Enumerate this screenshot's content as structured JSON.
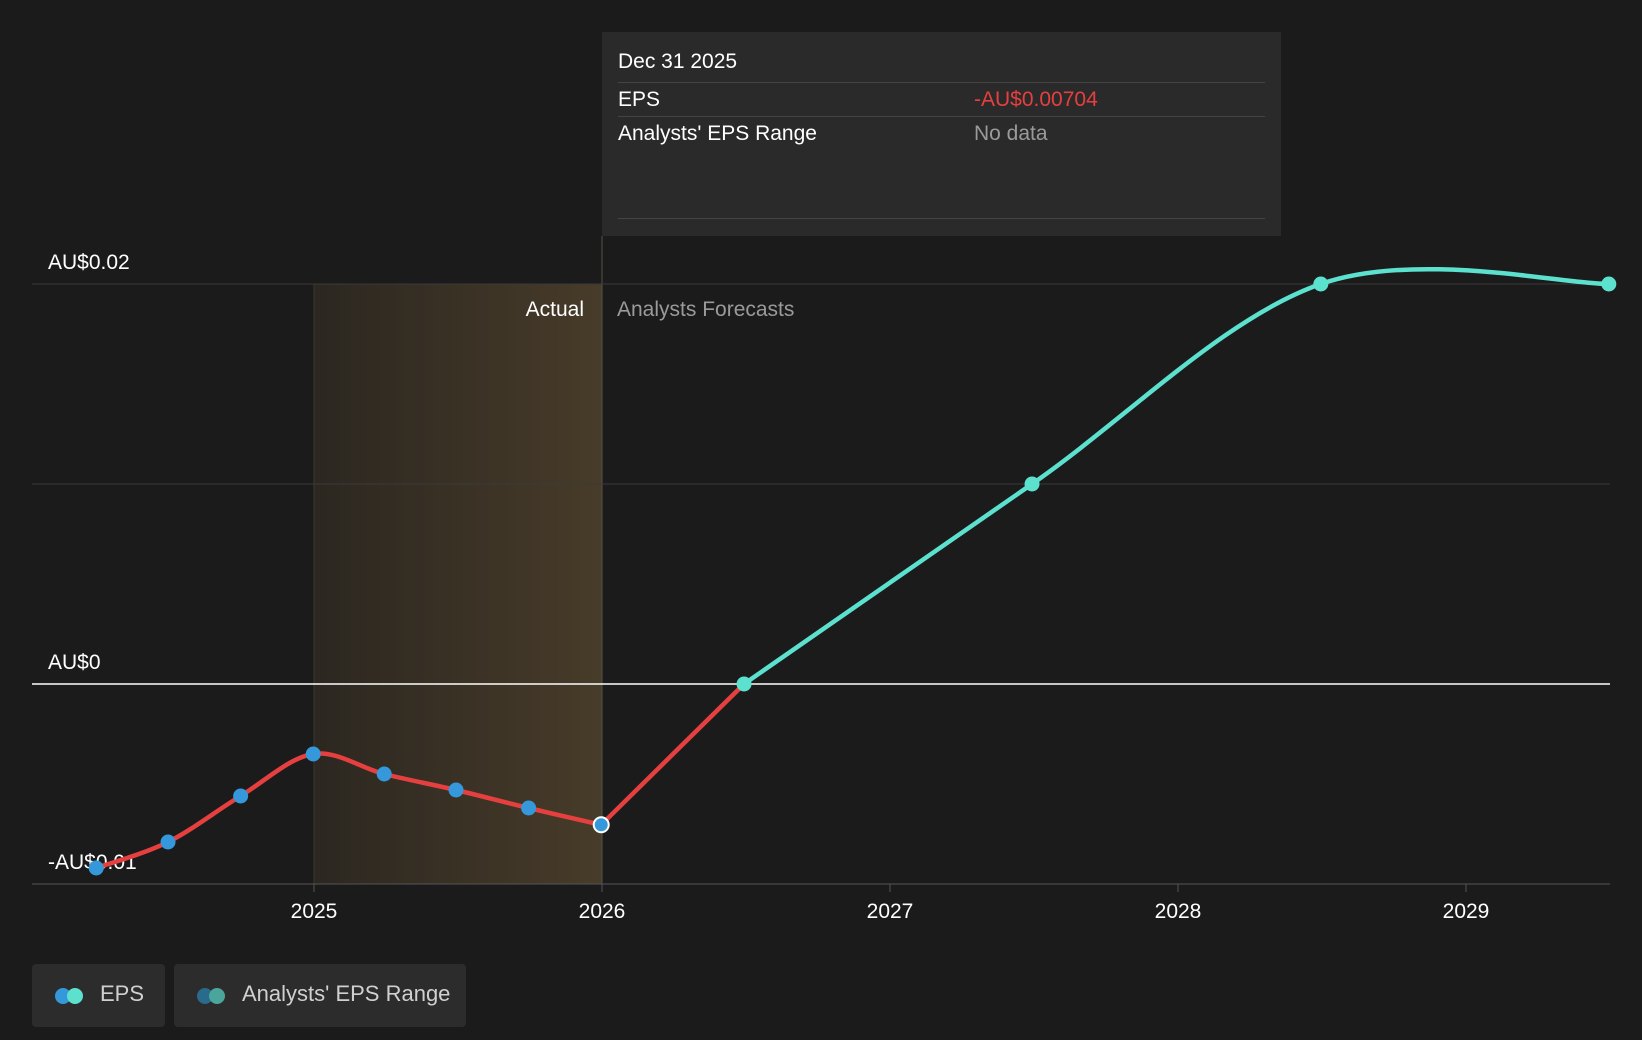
{
  "colors": {
    "background": "#1b1b1b",
    "actual_line": "#e5403f",
    "actual_point": "#3498db",
    "forecast": "#5ce1cf",
    "actual_shade": "#4a3d2a",
    "negative_value": "#e5403f",
    "muted_text": "#9a9a9a",
    "range_dot_dark": "#2a6a8a",
    "range_dot_light": "#4aa59a"
  },
  "chart_data": {
    "type": "line",
    "ylim": [
      -0.01,
      0.02
    ],
    "y_ticks": [
      {
        "value": 0.02,
        "label": "AU$0.02"
      },
      {
        "value": 0,
        "label": "AU$0"
      },
      {
        "value": -0.01,
        "label": "-AU$0.01"
      }
    ],
    "x_ticks": [
      "2025",
      "2026",
      "2027",
      "2028",
      "2029"
    ],
    "annotations": {
      "actual": "Actual",
      "forecast": "Analysts Forecasts"
    },
    "series": [
      {
        "name": "EPS",
        "segment": "actual",
        "points": [
          {
            "x": "2024-03-31",
            "y": -0.0092
          },
          {
            "x": "2024-06-30",
            "y": -0.0079
          },
          {
            "x": "2024-09-30",
            "y": -0.0056
          },
          {
            "x": "2024-12-31",
            "y": -0.0035
          },
          {
            "x": "2025-03-31",
            "y": -0.0045
          },
          {
            "x": "2025-06-30",
            "y": -0.0053
          },
          {
            "x": "2025-09-30",
            "y": -0.0062
          },
          {
            "x": "2025-12-31",
            "y": -0.00704
          }
        ]
      },
      {
        "name": "EPS",
        "segment": "forecast",
        "points": [
          {
            "x": "2025-12-31",
            "y": -0.00704
          },
          {
            "x": "2026-06-30",
            "y": 0.0
          },
          {
            "x": "2027-06-30",
            "y": 0.01
          },
          {
            "x": "2028-06-30",
            "y": 0.02
          },
          {
            "x": "2029-06-30",
            "y": 0.02
          }
        ]
      }
    ]
  },
  "tooltip": {
    "date": "Dec 31 2025",
    "rows": [
      {
        "label": "EPS",
        "value": "-AU$0.00704"
      },
      {
        "label": "Analysts' EPS Range",
        "value": "No data"
      }
    ]
  },
  "legend": {
    "items": [
      {
        "label": "EPS"
      },
      {
        "label": "Analysts' EPS Range"
      }
    ]
  }
}
